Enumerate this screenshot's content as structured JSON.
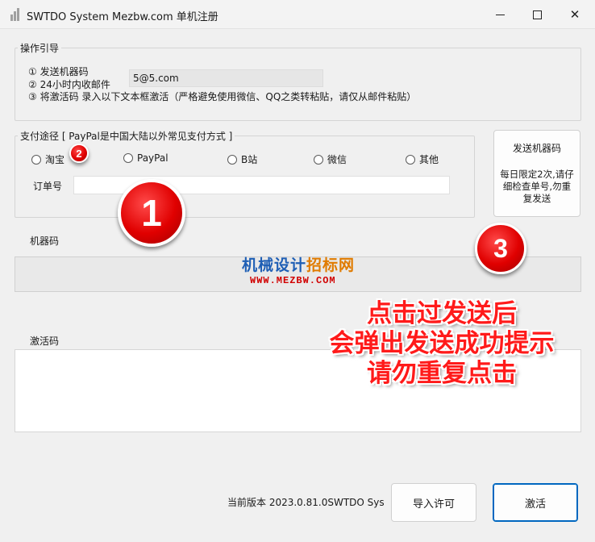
{
  "window": {
    "title": "SWTDO System Mezbw.com 单机注册",
    "minimize_icon": "minimize-icon",
    "maximize_icon": "maximize-icon",
    "close_symbol": "✕"
  },
  "guide": {
    "legend": "操作引导",
    "steps": [
      "① 发送机器码",
      "② 24小时内收邮件",
      "③ 将激活码 录入以下文本框激活（严格避免使用微信、QQ之类转粘贴，请仅从邮件粘贴）"
    ],
    "email_value": "5@5.com"
  },
  "payment": {
    "legend": "支付途径 [ PayPal是中国大陆以外常见支付方式 ]",
    "options": [
      "淘宝",
      "PayPal",
      "B站",
      "微信",
      "其他"
    ],
    "selected": null,
    "order_label": "订单号",
    "order_value": ""
  },
  "send_button": {
    "label": "发送机器码",
    "note": "每日限定2次,请仔细检查单号,勿重复发送"
  },
  "machine_code": {
    "label": "机器码",
    "value": ""
  },
  "activation_code": {
    "label": "激活码",
    "value": ""
  },
  "footer": {
    "version_text": "当前版本  2023.0.81.0SWTDO Sys",
    "import_label": "导入许可",
    "activate_label": "激活"
  },
  "annotations": {
    "badge_1": "1",
    "badge_2": "2",
    "badge_3": "3",
    "watermark_line1_main": "机械设计",
    "watermark_line1_accent": "招标网",
    "watermark_line2": "WWW.MEZBW.COM",
    "notice_lines": [
      "点击过发送后",
      "会弹出发送成功提示",
      "请勿重复点击"
    ]
  },
  "colors": {
    "accent": "#0067c0",
    "annotation_red": "#ff1a1a",
    "watermark_blue": "#1f5fb5"
  }
}
